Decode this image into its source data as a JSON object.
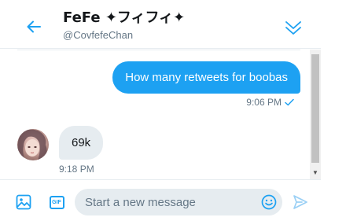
{
  "header": {
    "title": "FeFe ✦フィフィ✦",
    "handle": "@CovfefeChan"
  },
  "messages": [
    {
      "direction": "outgoing",
      "text": "How many retweets for boobas",
      "time": "9:06 PM",
      "status_icon": "checkmark-icon"
    },
    {
      "direction": "incoming",
      "text": "69k",
      "time": "9:18 PM",
      "avatar": "avatar-image"
    }
  ],
  "composer": {
    "placeholder": "Start a new message",
    "value": ""
  },
  "icons": {
    "back": "back-arrow-icon",
    "collapse": "double-chevron-down-icon",
    "media": "image-icon",
    "gif": "GIF",
    "emoji": "smiley-icon",
    "send": "send-icon",
    "scroll_down": "▼"
  },
  "colors": {
    "accent": "#1da1f2",
    "incoming_bubble": "#e6ecf0",
    "muted_text": "#657786",
    "primary_text": "#14171a"
  }
}
